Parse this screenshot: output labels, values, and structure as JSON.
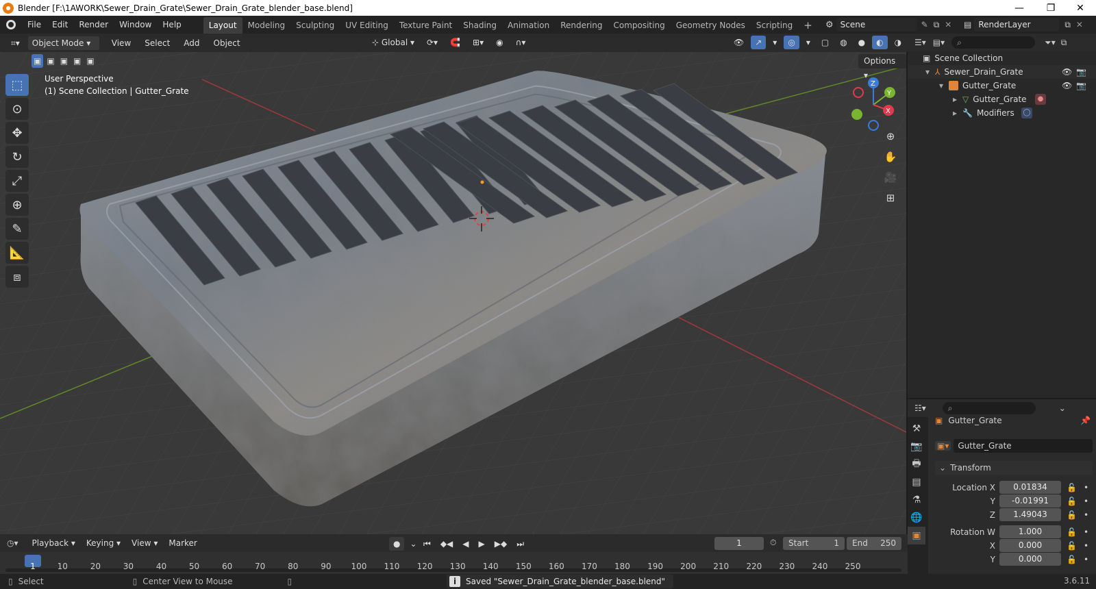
{
  "window": {
    "title": "Blender [F:\\1AWORK\\Sewer_Drain_Grate\\Sewer_Drain_Grate_blender_base.blend]",
    "minimize": "—",
    "maximize": "❐",
    "close": "✕"
  },
  "menu": [
    "File",
    "Edit",
    "Render",
    "Window",
    "Help"
  ],
  "workspaces": [
    "Layout",
    "Modeling",
    "Sculpting",
    "UV Editing",
    "Texture Paint",
    "Shading",
    "Animation",
    "Rendering",
    "Compositing",
    "Geometry Nodes",
    "Scripting"
  ],
  "active_workspace": "Layout",
  "add_workspace": "+",
  "scene": {
    "label": "Scene"
  },
  "view_layer": {
    "label": "RenderLayer"
  },
  "viewport_header": {
    "mode": "Object Mode",
    "menus": [
      "View",
      "Select",
      "Add",
      "Object"
    ],
    "orientation": "Global",
    "options_label": "Options"
  },
  "viewport": {
    "perspective": "User Perspective",
    "collection_info": "(1) Scene Collection | Gutter_Grate"
  },
  "outliner": {
    "root": "Scene Collection",
    "items": [
      {
        "label": "Sewer_Drain_Grate"
      },
      {
        "label": "Gutter_Grate"
      },
      {
        "label": "Gutter_Grate"
      },
      {
        "label": "Modifiers"
      }
    ]
  },
  "properties": {
    "object_name": "Gutter_Grate",
    "datablock_name": "Gutter_Grate",
    "panel": "Transform",
    "location_label": "Location X",
    "location": {
      "x": "0.01834",
      "y": "-0.01991",
      "z": "1.49043"
    },
    "rotation_label": "Rotation W",
    "rotation": {
      "w": "1.000",
      "x": "0.000",
      "y": "0.000"
    },
    "axis_labels": {
      "x": "X",
      "y": "Y",
      "z": "Z"
    }
  },
  "timeline": {
    "menus": [
      "Playback",
      "Keying",
      "View",
      "Marker"
    ],
    "current_frame": "1",
    "start_label": "Start",
    "start": "1",
    "end_label": "End",
    "end": "250",
    "ruler": [
      "1",
      "10",
      "20",
      "30",
      "40",
      "50",
      "60",
      "70",
      "80",
      "90",
      "100",
      "110",
      "120",
      "130",
      "140",
      "150",
      "160",
      "170",
      "180",
      "190",
      "200",
      "210",
      "220",
      "230",
      "240",
      "250"
    ]
  },
  "statusbar": {
    "left": "Select",
    "middle": "Center View to Mouse",
    "message": "Saved \"Sewer_Drain_Grate_blender_base.blend\"",
    "version": "3.6.11"
  }
}
